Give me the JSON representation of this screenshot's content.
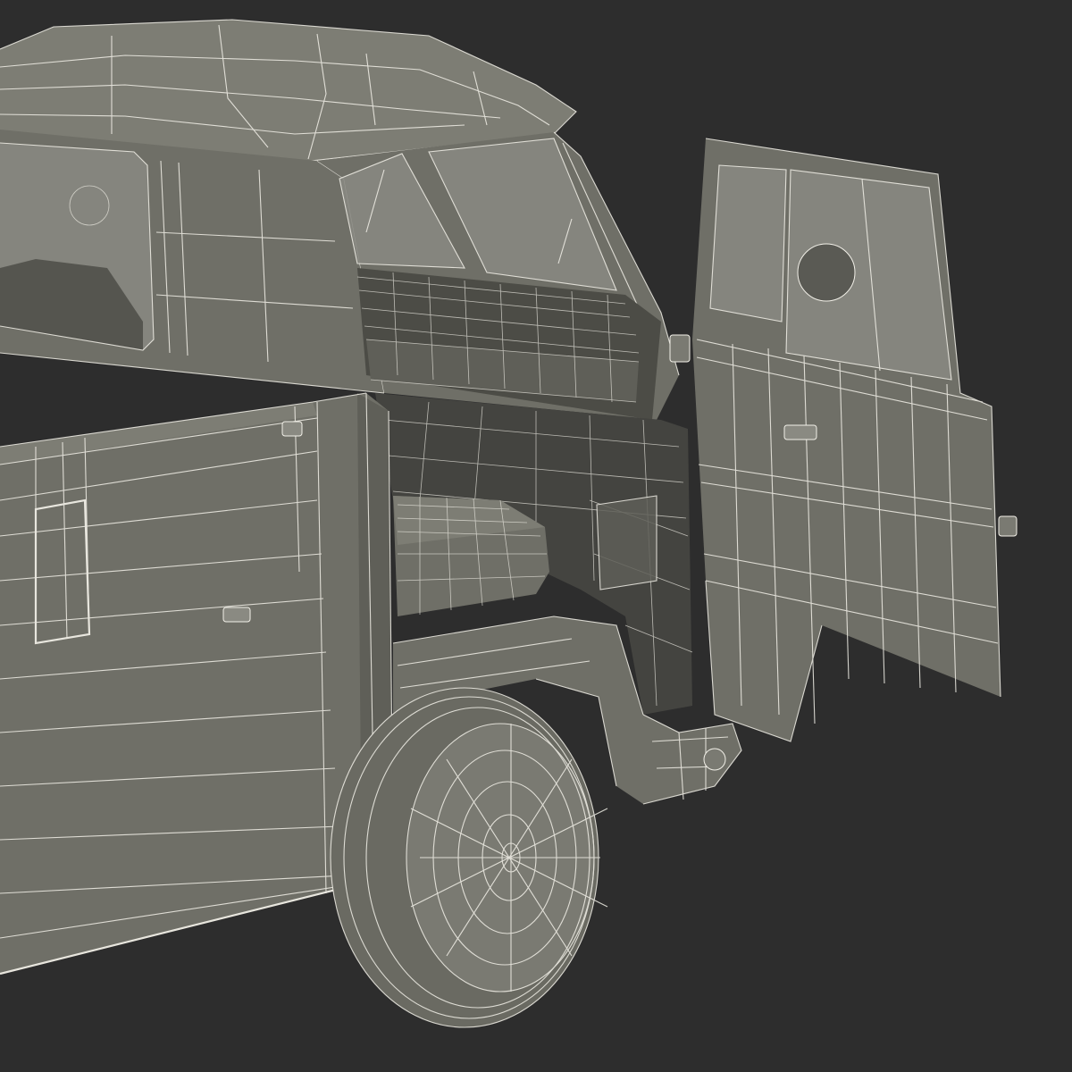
{
  "scene": {
    "background_color": "#2d2d2d",
    "body_color": "#6f6f67",
    "wire_color": "#f2f0e8",
    "subject": "wireframe-vehicle-render",
    "parts": [
      "roof",
      "rear-window",
      "windshield",
      "cargo-bed",
      "cab-interior",
      "seat",
      "dashboard",
      "open-door",
      "front-wheel",
      "front-fender",
      "bumper"
    ]
  }
}
